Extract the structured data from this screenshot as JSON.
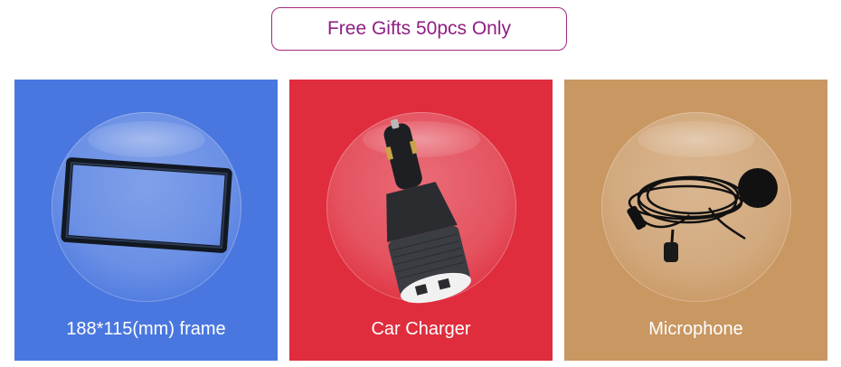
{
  "banner": {
    "text": "Free Gifts 50pcs Only",
    "border_color": "#a1287f",
    "text_color": "#8f1e83"
  },
  "gifts": [
    {
      "label": "188*115(mm) frame",
      "icon": "frame-icon",
      "background": "#4a77df"
    },
    {
      "label": "Car Charger",
      "icon": "car-charger-icon",
      "background": "#df2d3d"
    },
    {
      "label": "Microphone",
      "icon": "microphone-icon",
      "background": "#c99762"
    }
  ]
}
